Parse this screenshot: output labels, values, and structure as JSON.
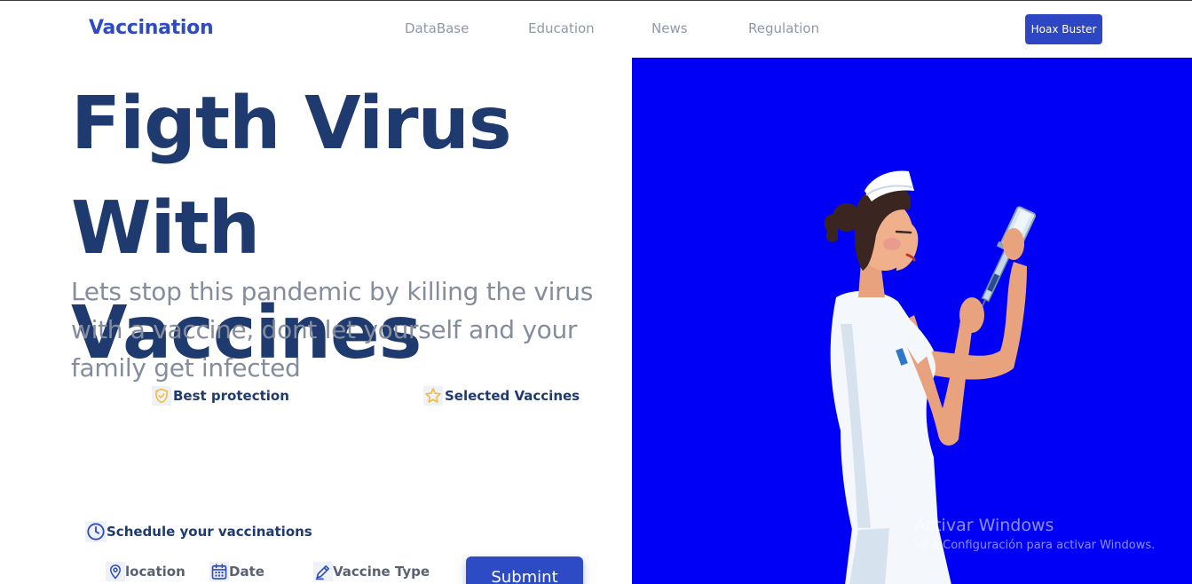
{
  "navbar": {
    "brand": "Vaccination",
    "links": [
      "DataBase",
      "Education",
      "News",
      "Regulation"
    ],
    "cta_label": "Hoax Buster"
  },
  "hero": {
    "title_line1": "Figth Virus",
    "title_line2": "With Vaccines",
    "subtitle": "Lets stop this pandemic by killing the virus with a vaccine, dont let yourself and your family get infected"
  },
  "features": [
    {
      "icon": "shield-check-icon",
      "label": "Best protection"
    },
    {
      "icon": "star-icon",
      "label": "Selected Vaccines"
    }
  ],
  "schedule": {
    "icon": "clock-icon",
    "title": "Schedule your vaccinations",
    "fields": [
      {
        "icon": "location-pin-icon",
        "label": "location"
      },
      {
        "icon": "calendar-icon",
        "label": "Date"
      },
      {
        "icon": "pen-icon",
        "label": "Vaccine Type"
      }
    ],
    "submit_label": "Submint"
  },
  "illustration": {
    "subject": "nurse-with-syringe",
    "background_color": "#0000f6"
  },
  "os_watermark": {
    "line1": "Activar Windows",
    "line2": "Ve a Configuración para activar Windows."
  },
  "colors": {
    "brand": "#2d4bc4",
    "heading": "#1f3a6e",
    "muted": "#858c9b",
    "accent_yellow": "#f5b731"
  }
}
